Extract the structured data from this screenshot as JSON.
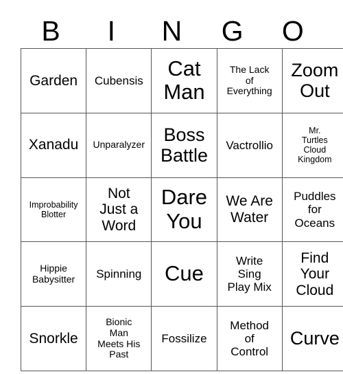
{
  "card": {
    "header": [
      "B",
      "I",
      "N",
      "G",
      "O"
    ],
    "colors": {
      "background": "#ffffff",
      "text": "#000000",
      "grid_line": "#555555"
    },
    "rows": [
      [
        {
          "text": "Garden",
          "size": "md"
        },
        {
          "text": "Cubensis",
          "size": "sm"
        },
        {
          "text": "Cat\nMan",
          "size": "xl"
        },
        {
          "text": "The Lack\nof\nEverything",
          "size": "xs"
        },
        {
          "text": "Zoom\nOut",
          "size": "lg"
        }
      ],
      [
        {
          "text": "Xanadu",
          "size": "md"
        },
        {
          "text": "Unparalyzer",
          "size": "xs"
        },
        {
          "text": "Boss\nBattle",
          "size": "lg"
        },
        {
          "text": "Vactrollio",
          "size": "sm"
        },
        {
          "text": "Mr.\nTurtles\nCloud\nKingdom",
          "size": "xxs"
        }
      ],
      [
        {
          "text": "Improbability\nBlotter",
          "size": "xxs"
        },
        {
          "text": "Not\nJust a\nWord",
          "size": "md"
        },
        {
          "text": "Dare\nYou",
          "size": "xl"
        },
        {
          "text": "We Are\nWater",
          "size": "md"
        },
        {
          "text": "Puddles\nfor\nOceans",
          "size": "sm"
        }
      ],
      [
        {
          "text": "Hippie\nBabysitter",
          "size": "xs"
        },
        {
          "text": "Spinning",
          "size": "sm"
        },
        {
          "text": "Cue",
          "size": "xl"
        },
        {
          "text": "Write\nSing\nPlay Mix",
          "size": "sm"
        },
        {
          "text": "Find\nYour\nCloud",
          "size": "md"
        }
      ],
      [
        {
          "text": "Snorkle",
          "size": "md"
        },
        {
          "text": "Bionic\nMan\nMeets His\nPast",
          "size": "xs"
        },
        {
          "text": "Fossilize",
          "size": "sm"
        },
        {
          "text": "Method\nof\nControl",
          "size": "sm"
        },
        {
          "text": "Curve",
          "size": "lg"
        }
      ]
    ]
  }
}
